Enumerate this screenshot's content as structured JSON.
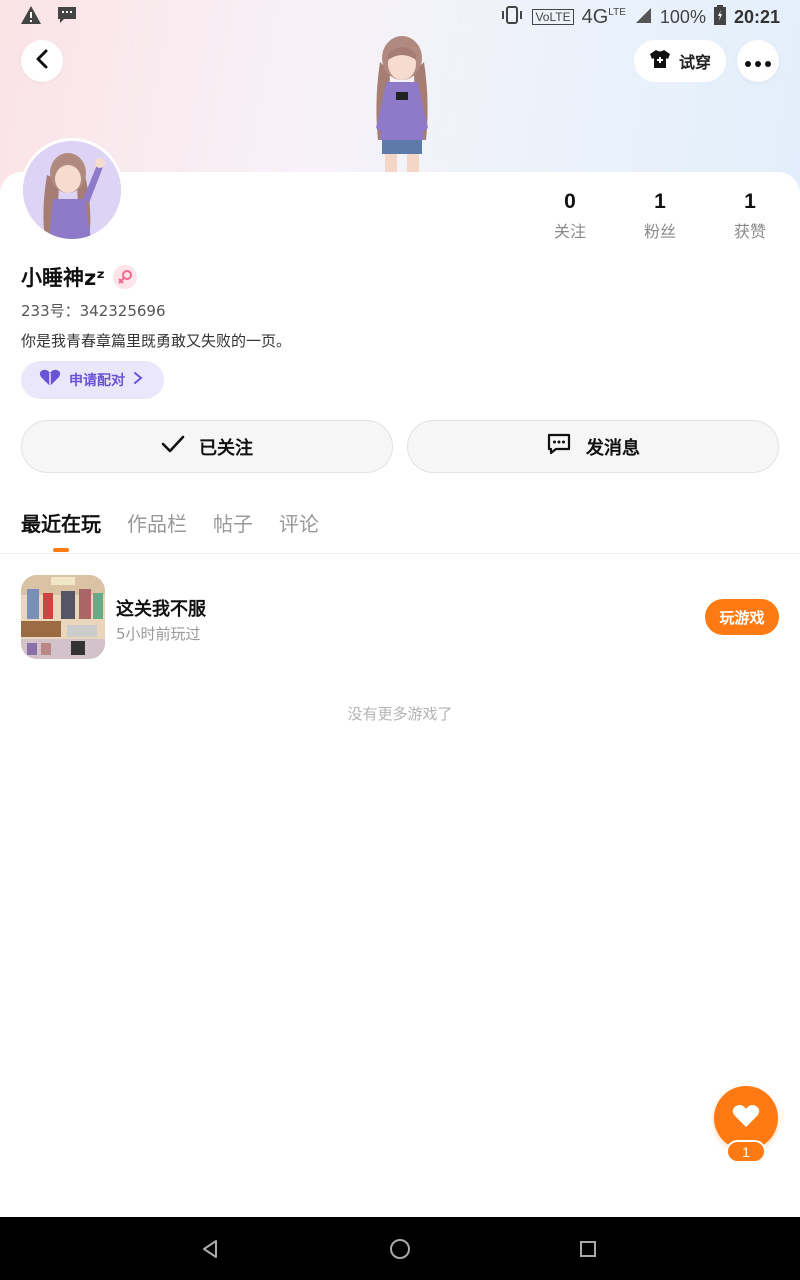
{
  "status_bar": {
    "left_icons": [
      "warning-icon",
      "message-icon"
    ],
    "network": "VoLTE",
    "signal": "4G",
    "lte": "LTE",
    "battery": "100%",
    "time": "20:21"
  },
  "header": {
    "tryon_label": "试穿"
  },
  "profile": {
    "username": "小睡神zᶻ",
    "uid": "233号：342325696",
    "bio": "你是我青春章篇里既勇敢又失败的一页。",
    "pair_label": "申请配对"
  },
  "stats": [
    {
      "value": "0",
      "label": "关注"
    },
    {
      "value": "1",
      "label": "粉丝"
    },
    {
      "value": "1",
      "label": "获赞"
    }
  ],
  "actions": {
    "follow_label": "已关注",
    "message_label": "发消息"
  },
  "tabs": [
    "最近在玩",
    "作品栏",
    "帖子",
    "评论"
  ],
  "games": [
    {
      "title": "这关我不服",
      "subtitle": "5小时前玩过",
      "button": "玩游戏"
    }
  ],
  "empty_text": "没有更多游戏了",
  "like": {
    "count": "1"
  },
  "colors": {
    "accent": "#ff7a12",
    "pair": "#6b53d6"
  }
}
